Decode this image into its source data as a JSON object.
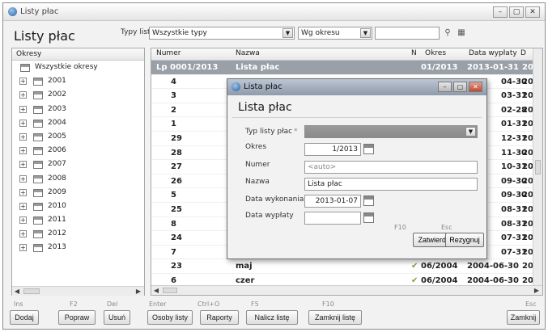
{
  "window": {
    "title": "Listy płac",
    "controls": {
      "minimize": "–",
      "maximize": "▢",
      "close": "✕"
    }
  },
  "header": {
    "title": "Listy płac",
    "typ_listy_label": "Typy list",
    "typ_listy_value": "Wszystkie typy",
    "period_filter_value": "Wg okresu",
    "period_extra_value": ""
  },
  "left_panel": {
    "column_header": "Okresy",
    "items": [
      {
        "label": "Wszystkie okresy",
        "expander": ""
      },
      {
        "label": "2001",
        "expander": "+"
      },
      {
        "label": "2002",
        "expander": "+"
      },
      {
        "label": "2003",
        "expander": "+"
      },
      {
        "label": "2004",
        "expander": "+"
      },
      {
        "label": "2005",
        "expander": "+"
      },
      {
        "label": "2006",
        "expander": "+"
      },
      {
        "label": "2007",
        "expander": "+"
      },
      {
        "label": "2008",
        "expander": "+"
      },
      {
        "label": "2009",
        "expander": "+"
      },
      {
        "label": "2010",
        "expander": "+"
      },
      {
        "label": "2011",
        "expander": "+"
      },
      {
        "label": "2012",
        "expander": "+"
      },
      {
        "label": "2013",
        "expander": "+"
      }
    ]
  },
  "grid": {
    "columns": [
      "Numer",
      "Nazwa",
      "N",
      "Okres",
      "Data wypłaty",
      "D"
    ],
    "rows": [
      {
        "numer": "Lp 0001/2013",
        "nazwa": "Lista płac",
        "n": "",
        "okres": "01/2013",
        "data": "2013-01-31",
        "d": "20",
        "selected": true
      },
      {
        "numer": "4",
        "nazwa": "",
        "n": "",
        "okres": "",
        "data": "04-30",
        "d": "20"
      },
      {
        "numer": "3",
        "nazwa": "",
        "n": "",
        "okres": "",
        "data": "03-31",
        "d": "20"
      },
      {
        "numer": "2",
        "nazwa": "",
        "n": "",
        "okres": "",
        "data": "02-28",
        "d": "20"
      },
      {
        "numer": "1",
        "nazwa": "",
        "n": "",
        "okres": "",
        "data": "01-31",
        "d": "20"
      },
      {
        "numer": "29",
        "nazwa": "",
        "n": "",
        "okres": "",
        "data": "12-31",
        "d": "20"
      },
      {
        "numer": "28",
        "nazwa": "",
        "n": "",
        "okres": "",
        "data": "11-30",
        "d": "20"
      },
      {
        "numer": "27",
        "nazwa": "",
        "n": "",
        "okres": "",
        "data": "10-31",
        "d": "20"
      },
      {
        "numer": "26",
        "nazwa": "",
        "n": "",
        "okres": "",
        "data": "09-30",
        "d": "20"
      },
      {
        "numer": "5",
        "nazwa": "",
        "n": "",
        "okres": "",
        "data": "09-30",
        "d": "20"
      },
      {
        "numer": "25",
        "nazwa": "",
        "n": "",
        "okres": "",
        "data": "08-31",
        "d": "20"
      },
      {
        "numer": "8",
        "nazwa": "",
        "n": "",
        "okres": "",
        "data": "08-31",
        "d": "20"
      },
      {
        "numer": "24",
        "nazwa": "",
        "n": "",
        "okres": "",
        "data": "07-31",
        "d": "20"
      },
      {
        "numer": "7",
        "nazwa": "",
        "n": "",
        "okres": "",
        "data": "07-31",
        "d": "20"
      },
      {
        "numer": "23",
        "nazwa": "maj",
        "n": "✔",
        "okres": "06/2004",
        "data": "2004-06-30",
        "d": "20"
      },
      {
        "numer": "6",
        "nazwa": "czer",
        "n": "✔",
        "okres": "06/2004",
        "data": "2004-06-30",
        "d": "20"
      }
    ]
  },
  "bottom_bar": {
    "keys": [
      "Ins",
      "F2",
      "Del",
      "Enter",
      "Ctrl+O",
      "F5",
      "F10",
      "Esc"
    ],
    "buttons": {
      "dodaj": "Dodaj",
      "popraw": "Popraw",
      "usun": "Usuń",
      "osoby": "Osoby listy",
      "raporty": "Raporty",
      "nalicz": "Nalicz listę",
      "zamknij_liste": "Zamknij listę",
      "zamknij": "Zamknij"
    }
  },
  "dialog": {
    "title": "Lista płac",
    "heading": "Lista płac",
    "fields": {
      "typ_label": "Typ listy płac",
      "typ_required": "*",
      "okres_label": "Okres",
      "okres_value": "1/2013",
      "numer_label": "Numer",
      "numer_value": "<auto>",
      "nazwa_label": "Nazwa",
      "nazwa_value": "Lista płac",
      "data_wyk_label": "Data wykonania",
      "data_wyk_value": "2013-01-07",
      "data_wyp_label": "Data wypłaty",
      "data_wyp_value": ""
    },
    "keys": {
      "confirm": "F10",
      "cancel": "Esc"
    },
    "buttons": {
      "confirm": "Zatwierdź",
      "cancel": "Rezygnuj"
    }
  }
}
